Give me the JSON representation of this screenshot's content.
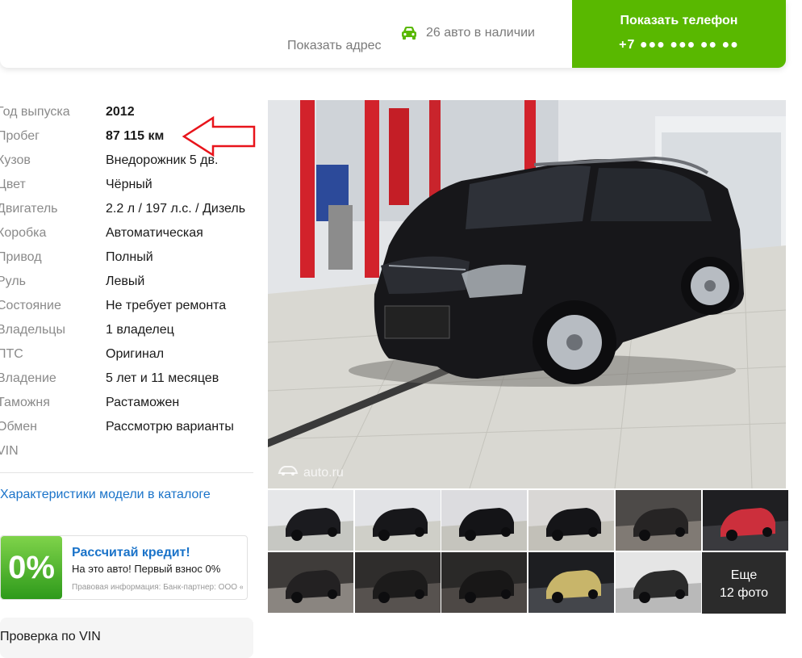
{
  "header": {
    "show_address": "Показать адрес",
    "stock_text": "26 авто в наличии",
    "phone_button_label": "Показать телефон",
    "phone_masked": "+7 ●●● ●●● ●● ●●",
    "accent_color": "#59b800"
  },
  "specs": [
    {
      "key": "Год выпуска",
      "value": "2012",
      "bold": true
    },
    {
      "key": "Пробег",
      "value": "87 115 км",
      "bold": true
    },
    {
      "key": "Кузов",
      "value": "Внедорожник 5 дв."
    },
    {
      "key": "Цвет",
      "value": "Чёрный"
    },
    {
      "key": "Двигатель",
      "value": "2.2 л / 197 л.с. / Дизель"
    },
    {
      "key": "Коробка",
      "value": "Автоматическая"
    },
    {
      "key": "Привод",
      "value": "Полный"
    },
    {
      "key": "Руль",
      "value": "Левый"
    },
    {
      "key": "Состояние",
      "value": "Не требует ремонта"
    },
    {
      "key": "Владельцы",
      "value": "1 владелец"
    },
    {
      "key": "ПТС",
      "value": "Оригинал"
    },
    {
      "key": "Владение",
      "value": "5 лет и 11 месяцев"
    },
    {
      "key": "Таможня",
      "value": "Растаможен"
    },
    {
      "key": "Обмен",
      "value": "Рассмотрю варианты"
    },
    {
      "key": "VIN",
      "value": ""
    }
  ],
  "catalog_link": "Характеристики модели в каталоге",
  "credit": {
    "badge": "0%",
    "title": "Рассчитай кредит!",
    "subtitle": "На это авто! Первый взнос 0%",
    "legal": "Правовая информация: Банк-партнер: ООО «"
  },
  "vin_check": "Проверка по VIN",
  "gallery": {
    "watermark": "auto.ru",
    "more_line1": "Еще",
    "more_line2": "12 фото",
    "thumb_icons": [
      "car-front-thumb-icon",
      "car-front-thumb-icon",
      "car-rear-thumb-icon",
      "car-rear-thumb-icon",
      "interior-thumb-icon",
      "dashboard-thumb-icon",
      "interior-thumb-icon",
      "seat-thumb-icon",
      "seat-thumb-icon",
      "screen-thumb-icon",
      "gearbox-thumb-icon"
    ]
  }
}
